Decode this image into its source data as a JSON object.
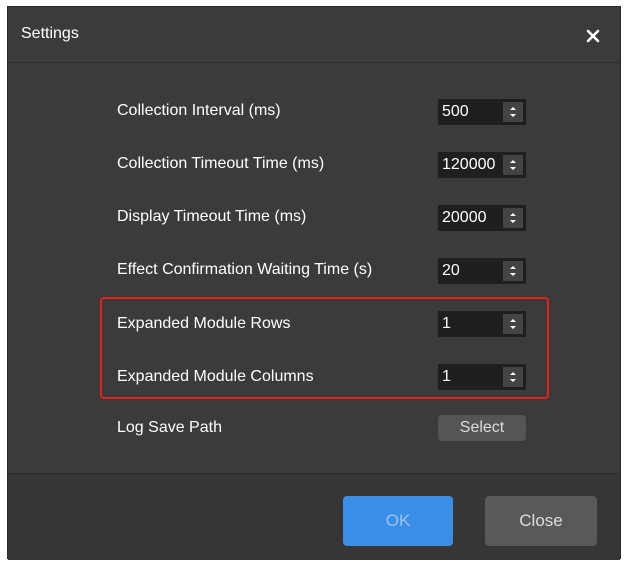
{
  "dialog": {
    "title": "Settings",
    "close_icon": "close-icon"
  },
  "settings": [
    {
      "label": "Collection Interval (ms)",
      "value": "500"
    },
    {
      "label": "Collection Timeout Time (ms)",
      "value": "120000"
    },
    {
      "label": "Display Timeout Time (ms)",
      "value": "20000"
    },
    {
      "label": "Effect Confirmation Waiting Time (s)",
      "value": "20"
    },
    {
      "label": "Expanded Module Rows",
      "value": "1"
    },
    {
      "label": "Expanded Module Columns",
      "value": "1"
    }
  ],
  "log_path": {
    "label": "Log Save Path",
    "button_label": "Select"
  },
  "footer": {
    "ok_label": "OK",
    "close_label": "Close"
  },
  "colors": {
    "dialog_bg": "#3b3b3b",
    "input_bg": "#1f1f1f",
    "ok_button": "#3a8ee6",
    "highlight": "#e8201c"
  }
}
